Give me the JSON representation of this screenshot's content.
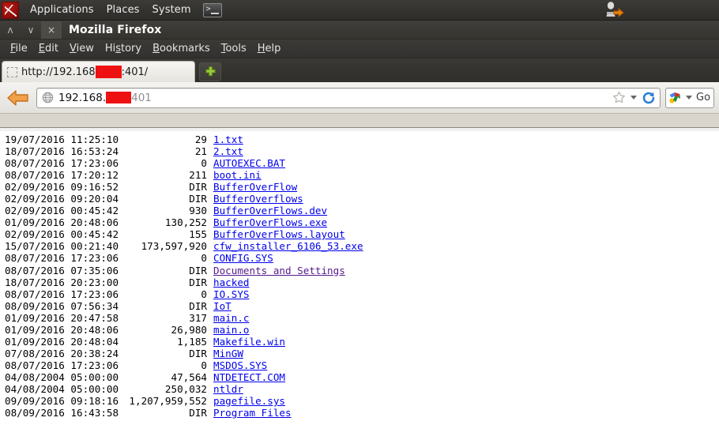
{
  "desktop": {
    "logo_icon": "kali-dragon-logo",
    "menus": [
      {
        "label": "Applications",
        "name": "applications-menu"
      },
      {
        "label": "Places",
        "name": "places-menu"
      },
      {
        "label": "System",
        "name": "system-menu"
      }
    ],
    "terminal_launcher": {
      "icon": "terminal-icon",
      "glyph": ">_"
    },
    "logout_icon": "user-logout-icon"
  },
  "window": {
    "title": "Mozilla Firefox",
    "controls": {
      "maximize": "ʌ",
      "minimize": "∨",
      "close": "×"
    }
  },
  "menubar": [
    {
      "name": "menu-file",
      "pre": "",
      "accel": "F",
      "post": "ile"
    },
    {
      "name": "menu-edit",
      "pre": "",
      "accel": "E",
      "post": "dit"
    },
    {
      "name": "menu-view",
      "pre": "",
      "accel": "V",
      "post": "iew"
    },
    {
      "name": "menu-history",
      "pre": "Hi",
      "accel": "s",
      "post": "tory"
    },
    {
      "name": "menu-bookmarks",
      "pre": "",
      "accel": "B",
      "post": "ookmarks"
    },
    {
      "name": "menu-tools",
      "pre": "",
      "accel": "T",
      "post": "ools"
    },
    {
      "name": "menu-help",
      "pre": "",
      "accel": "H",
      "post": "elp"
    }
  ],
  "tabs": {
    "active": {
      "prefix": "http://192.168",
      "redacted": "",
      "suffix": ":401/"
    },
    "new_tab_label": "+"
  },
  "navbar": {
    "back_icon": "back-arrow-icon",
    "url": {
      "prefix": "192.168.",
      "redacted": "",
      "suffix": "401"
    },
    "star_icon": "bookmark-star-icon",
    "reload_icon": "reload-icon",
    "search_engine": "google-icon",
    "search_label": "Go"
  },
  "colors": {
    "link": "#0000ee",
    "visited": "#551a8b",
    "redaction": "#ee1111",
    "accent_orange": "#e8820c"
  },
  "listing": {
    "columns": [
      "date",
      "size",
      "name"
    ],
    "rows": [
      {
        "date": "19/07/2016 11:25:10",
        "size": "29",
        "name": "1.txt",
        "visited": false
      },
      {
        "date": "18/07/2016 16:53:24",
        "size": "21",
        "name": "2.txt",
        "visited": false
      },
      {
        "date": "08/07/2016 17:23:06",
        "size": "0",
        "name": "AUTOEXEC.BAT",
        "visited": false
      },
      {
        "date": "08/07/2016 17:20:12",
        "size": "211",
        "name": "boot.ini",
        "visited": false
      },
      {
        "date": "02/09/2016 09:16:52",
        "size": "DIR",
        "name": "BufferOverFlow",
        "visited": false
      },
      {
        "date": "02/09/2016 09:20:04",
        "size": "DIR",
        "name": "BufferOverflows",
        "visited": false
      },
      {
        "date": "02/09/2016 00:45:42",
        "size": "930",
        "name": "BufferOverFlows.dev",
        "visited": false
      },
      {
        "date": "01/09/2016 20:48:06",
        "size": "130,252",
        "name": "BufferOverFlows.exe",
        "visited": false
      },
      {
        "date": "02/09/2016 00:45:42",
        "size": "155",
        "name": "BufferOverFlows.layout",
        "visited": false
      },
      {
        "date": "15/07/2016 00:21:40",
        "size": "173,597,920",
        "name": "cfw_installer_6106_53.exe",
        "visited": false
      },
      {
        "date": "08/07/2016 17:23:06",
        "size": "0",
        "name": "CONFIG.SYS",
        "visited": false
      },
      {
        "date": "08/07/2016 07:35:06",
        "size": "DIR",
        "name": "Documents and Settings",
        "visited": true
      },
      {
        "date": "18/07/2016 20:23:00",
        "size": "DIR",
        "name": "hacked",
        "visited": false
      },
      {
        "date": "08/07/2016 17:23:06",
        "size": "0",
        "name": "IO.SYS",
        "visited": false
      },
      {
        "date": "08/09/2016 07:56:34",
        "size": "DIR",
        "name": "IoT",
        "visited": false
      },
      {
        "date": "01/09/2016 20:47:58",
        "size": "317",
        "name": "main.c",
        "visited": false
      },
      {
        "date": "01/09/2016 20:48:06",
        "size": "26,980",
        "name": "main.o",
        "visited": false
      },
      {
        "date": "01/09/2016 20:48:04",
        "size": "1,185",
        "name": "Makefile.win",
        "visited": false
      },
      {
        "date": "07/08/2016 20:38:24",
        "size": "DIR",
        "name": "MinGW",
        "visited": false
      },
      {
        "date": "08/07/2016 17:23:06",
        "size": "0",
        "name": "MSDOS.SYS",
        "visited": false
      },
      {
        "date": "04/08/2004 05:00:00",
        "size": "47,564",
        "name": "NTDETECT.COM",
        "visited": false
      },
      {
        "date": "04/08/2004 05:00:00",
        "size": "250,032",
        "name": "ntldr",
        "visited": false
      },
      {
        "date": "09/09/2016 09:18:16",
        "size": "1,207,959,552",
        "name": "pagefile.sys",
        "visited": false
      },
      {
        "date": "08/09/2016 16:43:58",
        "size": "DIR",
        "name": "Program Files",
        "visited": false
      }
    ]
  }
}
